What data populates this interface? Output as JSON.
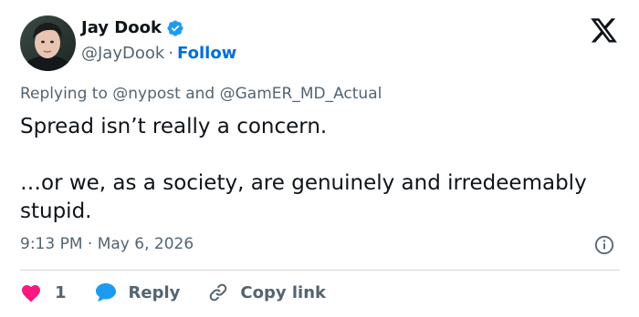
{
  "author": {
    "name": "Jay Dook",
    "handle": "@JayDook",
    "separator": "·",
    "follow_label": "Follow"
  },
  "reply_context": {
    "prefix": "Replying to",
    "user1": "@nypost",
    "conjunction": "and",
    "user2": "@GamER_MD_Actual"
  },
  "tweet": {
    "paragraph1": "Spread isn’t really a concern.",
    "paragraph2": "…or we, as a society, are genuinely and irredeemably stupid."
  },
  "timestamp": {
    "time": "9:13 PM",
    "separator": "·",
    "date": "May 6, 2026"
  },
  "actions": {
    "like_count": "1",
    "reply_label": "Reply",
    "copy_link_label": "Copy link"
  },
  "icons": {
    "verified": "verified-badge-icon",
    "logo": "x-logo-icon",
    "info": "info-icon",
    "like": "heart-icon",
    "reply": "speech-bubble-icon",
    "copy": "link-icon"
  },
  "colors": {
    "verified": "#1d9bf0",
    "follow": "#006fd6",
    "like": "#f91880",
    "reply": "#1d9bf0",
    "secondary_text": "#536471"
  }
}
